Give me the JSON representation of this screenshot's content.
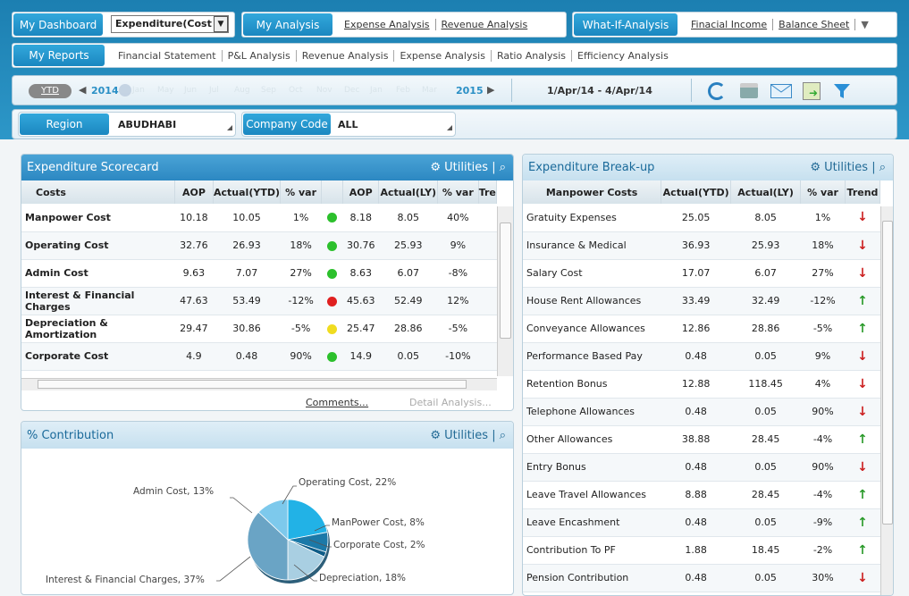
{
  "nav": {
    "dashboard": "My Dashboard",
    "dashboard_select": "Expenditure(Cost t",
    "analysis": "My Analysis",
    "analysis_links": [
      "Expense Analysis",
      "Revenue Analysis"
    ],
    "whatif": "What-If-Analysis",
    "whatif_links": [
      "Finacial Income",
      "Balance Sheet"
    ],
    "reports": "My Reports",
    "report_links": [
      "Financial Statement",
      "P&L Analysis",
      "Revenue Analysis",
      "Expense Analysis",
      "Ratio Analysis",
      "Efficiency Analysis"
    ]
  },
  "timebar": {
    "ytd": "YTD",
    "year_start": "2014",
    "months": [
      "Jan",
      "May",
      "Jun",
      "Jul",
      "Aug",
      "Sep",
      "Oct",
      "Nov",
      "Dec",
      "Jan",
      "Feb",
      "Mar"
    ],
    "year_end": "2015",
    "range": "1/Apr/14 - 4/Apr/14"
  },
  "filters": {
    "region_label": "Region",
    "region_value": "ABUDHABI",
    "company_label": "Company Code",
    "company_value": "ALL"
  },
  "scorecard": {
    "title": "Expenditure Scorecard",
    "utilities": "Utilities",
    "headers": [
      "Costs",
      "AOP",
      "Actual(YTD)",
      "% var",
      "",
      "AOP",
      "Actual(LY)",
      "% var",
      "Tre"
    ],
    "rows": [
      [
        "Manpower Cost",
        "10.18",
        "10.05",
        "1%",
        "green",
        "8.18",
        "8.05",
        "40%"
      ],
      [
        "Operating Cost",
        "32.76",
        "26.93",
        "18%",
        "green",
        "30.76",
        "25.93",
        "9%"
      ],
      [
        "Admin Cost",
        "9.63",
        "7.07",
        "27%",
        "green",
        "8.63",
        "6.07",
        "-8%"
      ],
      [
        "Interest & Financial Charges",
        "47.63",
        "53.49",
        "-12%",
        "red",
        "45.63",
        "52.49",
        "12%"
      ],
      [
        "Depreciation & Amortization",
        "29.47",
        "30.86",
        "-5%",
        "yellow",
        "25.47",
        "28.86",
        "-5%"
      ],
      [
        "Corporate Cost",
        "4.9",
        "0.48",
        "90%",
        "green",
        "14.9",
        "0.05",
        "-10%"
      ]
    ],
    "comments": "Comments...",
    "detail": "Detail Analysis..."
  },
  "contribution": {
    "title": "% Contribution",
    "utilities": "Utilities",
    "labels": [
      "Admin Cost, 13%",
      "Operating Cost, 22%",
      "ManPower Cost, 8%",
      "Corporate Cost, 2%",
      "Depreciation, 18%",
      "Interest & Financial Charges, 37%"
    ]
  },
  "chart_data": {
    "type": "pie",
    "title": "% Contribution",
    "categories": [
      "Operating Cost",
      "ManPower Cost",
      "Corporate Cost",
      "Depreciation",
      "Interest & Financial Charges",
      "Admin Cost"
    ],
    "values": [
      22,
      8,
      2,
      18,
      37,
      13
    ],
    "colors": [
      "#22b2e6",
      "#1b79a8",
      "#0f5d88",
      "#a9cfe2",
      "#6aa4c5",
      "#7dc9ec"
    ]
  },
  "breakup": {
    "title": "Expenditure Break-up",
    "utilities": "Utilities",
    "headers": [
      "Manpower Costs",
      "Actual(YTD)",
      "Actual(LY)",
      "% var",
      "Trend"
    ],
    "rows": [
      [
        "Gratuity Expenses",
        "25.05",
        "8.05",
        "1%",
        "down"
      ],
      [
        "Insurance & Medical",
        "36.93",
        "25.93",
        "18%",
        "down"
      ],
      [
        "Salary Cost",
        "17.07",
        "6.07",
        "27%",
        "down"
      ],
      [
        "House Rent Allowances",
        "33.49",
        "32.49",
        "-12%",
        "up"
      ],
      [
        "Conveyance Allowances",
        "12.86",
        "28.86",
        "-5%",
        "up"
      ],
      [
        "Performance Based Pay",
        "0.48",
        "0.05",
        "9%",
        "down"
      ],
      [
        "Retention Bonus",
        "12.88",
        "118.45",
        "4%",
        "down"
      ],
      [
        "Telephone Allowances",
        "0.48",
        "0.05",
        "90%",
        "down"
      ],
      [
        "Other Allowances",
        "38.88",
        "28.45",
        "-4%",
        "up"
      ],
      [
        "Entry Bonus",
        "0.48",
        "0.05",
        "90%",
        "down"
      ],
      [
        "Leave Travel Allowances",
        "8.88",
        "28.45",
        "-4%",
        "up"
      ],
      [
        "Leave Encashment",
        "0.48",
        "0.05",
        "-9%",
        "up"
      ],
      [
        "Contribution To PF",
        "1.88",
        "18.45",
        "-2%",
        "up"
      ],
      [
        "Pension Contribution",
        "0.48",
        "0.05",
        "30%",
        "down"
      ]
    ]
  }
}
